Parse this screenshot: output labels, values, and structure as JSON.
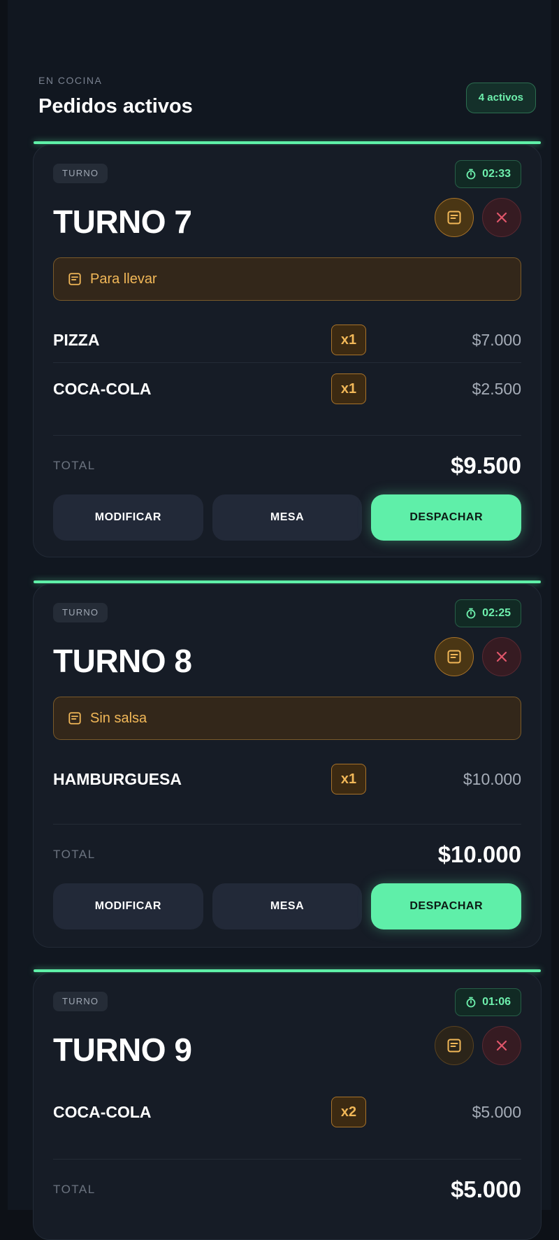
{
  "header": {
    "eyebrow": "EN COCINA",
    "title": "Pedidos activos",
    "active_count": "4 activos"
  },
  "orders": [
    {
      "tag": "TURNO",
      "timer": "02:33",
      "name": "TURNO 7",
      "note": "Para llevar",
      "items": [
        {
          "name": "PIZZA",
          "qty": "x1",
          "price": "$7.000"
        },
        {
          "name": "COCA-COLA",
          "qty": "x1",
          "price": "$2.500"
        }
      ],
      "total_label": "TOTAL",
      "total": "$9.500",
      "actions": {
        "modify": "MODIFICAR",
        "table": "MESA",
        "dispatch": "DESPACHAR"
      }
    },
    {
      "tag": "TURNO",
      "timer": "02:25",
      "name": "TURNO 8",
      "note": "Sin salsa",
      "items": [
        {
          "name": "HAMBURGUESA",
          "qty": "x1",
          "price": "$10.000"
        }
      ],
      "total_label": "TOTAL",
      "total": "$10.000",
      "actions": {
        "modify": "MODIFICAR",
        "table": "MESA",
        "dispatch": "DESPACHAR"
      }
    },
    {
      "tag": "TURNO",
      "timer": "01:06",
      "name": "TURNO 9",
      "items": [
        {
          "name": "COCA-COLA",
          "qty": "x2",
          "price": "$5.000"
        }
      ],
      "total_label": "TOTAL",
      "total": "$5.000"
    }
  ],
  "colors": {
    "accent": "#5fefa9",
    "note": "#f2b858",
    "danger": "#e0566a",
    "background": "#111720"
  },
  "icons": {
    "timer": "stopwatch-icon",
    "note": "note-icon",
    "close": "close-icon"
  }
}
